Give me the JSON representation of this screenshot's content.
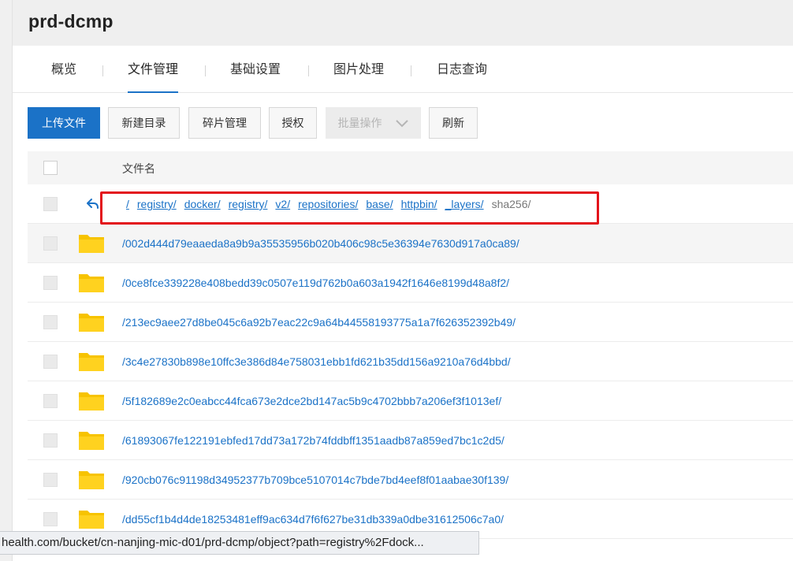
{
  "header": {
    "title": "prd-dcmp"
  },
  "tabs": [
    {
      "label": "概览"
    },
    {
      "label": "文件管理"
    },
    {
      "label": "基础设置"
    },
    {
      "label": "图片处理"
    },
    {
      "label": "日志查询"
    }
  ],
  "toolbar": {
    "upload": "上传文件",
    "new_dir": "新建目录",
    "fragments": "碎片管理",
    "authorize": "授权",
    "batch": "批量操作",
    "refresh": "刷新"
  },
  "table": {
    "header_name": "文件名",
    "breadcrumb": [
      "/",
      "registry/",
      "docker/",
      "registry/",
      "v2/",
      "repositories/",
      "base/",
      "httpbin/",
      "_layers/"
    ],
    "breadcrumb_current": "sha256/",
    "rows": [
      {
        "name": "/002d444d79eaaeda8a9b9a35535956b020b406c98c5e36394e7630d917a0ca89/"
      },
      {
        "name": "/0ce8fce339228e408bedd39c0507e119d762b0a603a1942f1646e8199d48a8f2/"
      },
      {
        "name": "/213ec9aee27d8be045c6a92b7eac22c9a64b44558193775a1a7f626352392b49/"
      },
      {
        "name": "/3c4e27830b898e10ffc3e386d84e758031ebb1fd621b35dd156a9210a76d4bbd/"
      },
      {
        "name": "/5f182689e2c0eabcc44fca673e2dce2bd147ac5b9c4702bbb7a206ef3f1013ef/"
      },
      {
        "name": "/61893067fe122191ebfed17dd73a172b74fddbff1351aadb87a859ed7bc1c2d5/"
      },
      {
        "name": "/920cb076c91198d34952377b709bce5107014c7bde7bd4eef8f01aabae30f139/"
      },
      {
        "name": "/dd55cf1b4d4de18253481eff9ac634d7f6f627be31db339a0dbe31612506c7a0/"
      }
    ]
  },
  "statusbar": {
    "url": "health.com/bucket/cn-nanjing-mic-d01/prd-dcmp/object?path=registry%2Fdock..."
  },
  "colors": {
    "accent": "#1b72c7",
    "folder": "#f7c300",
    "highlight_box": "#e3131b"
  },
  "icons": {
    "back": "back-arrow-icon",
    "folder": "folder-icon",
    "batch_dropdown": "chevron-down-icon"
  }
}
